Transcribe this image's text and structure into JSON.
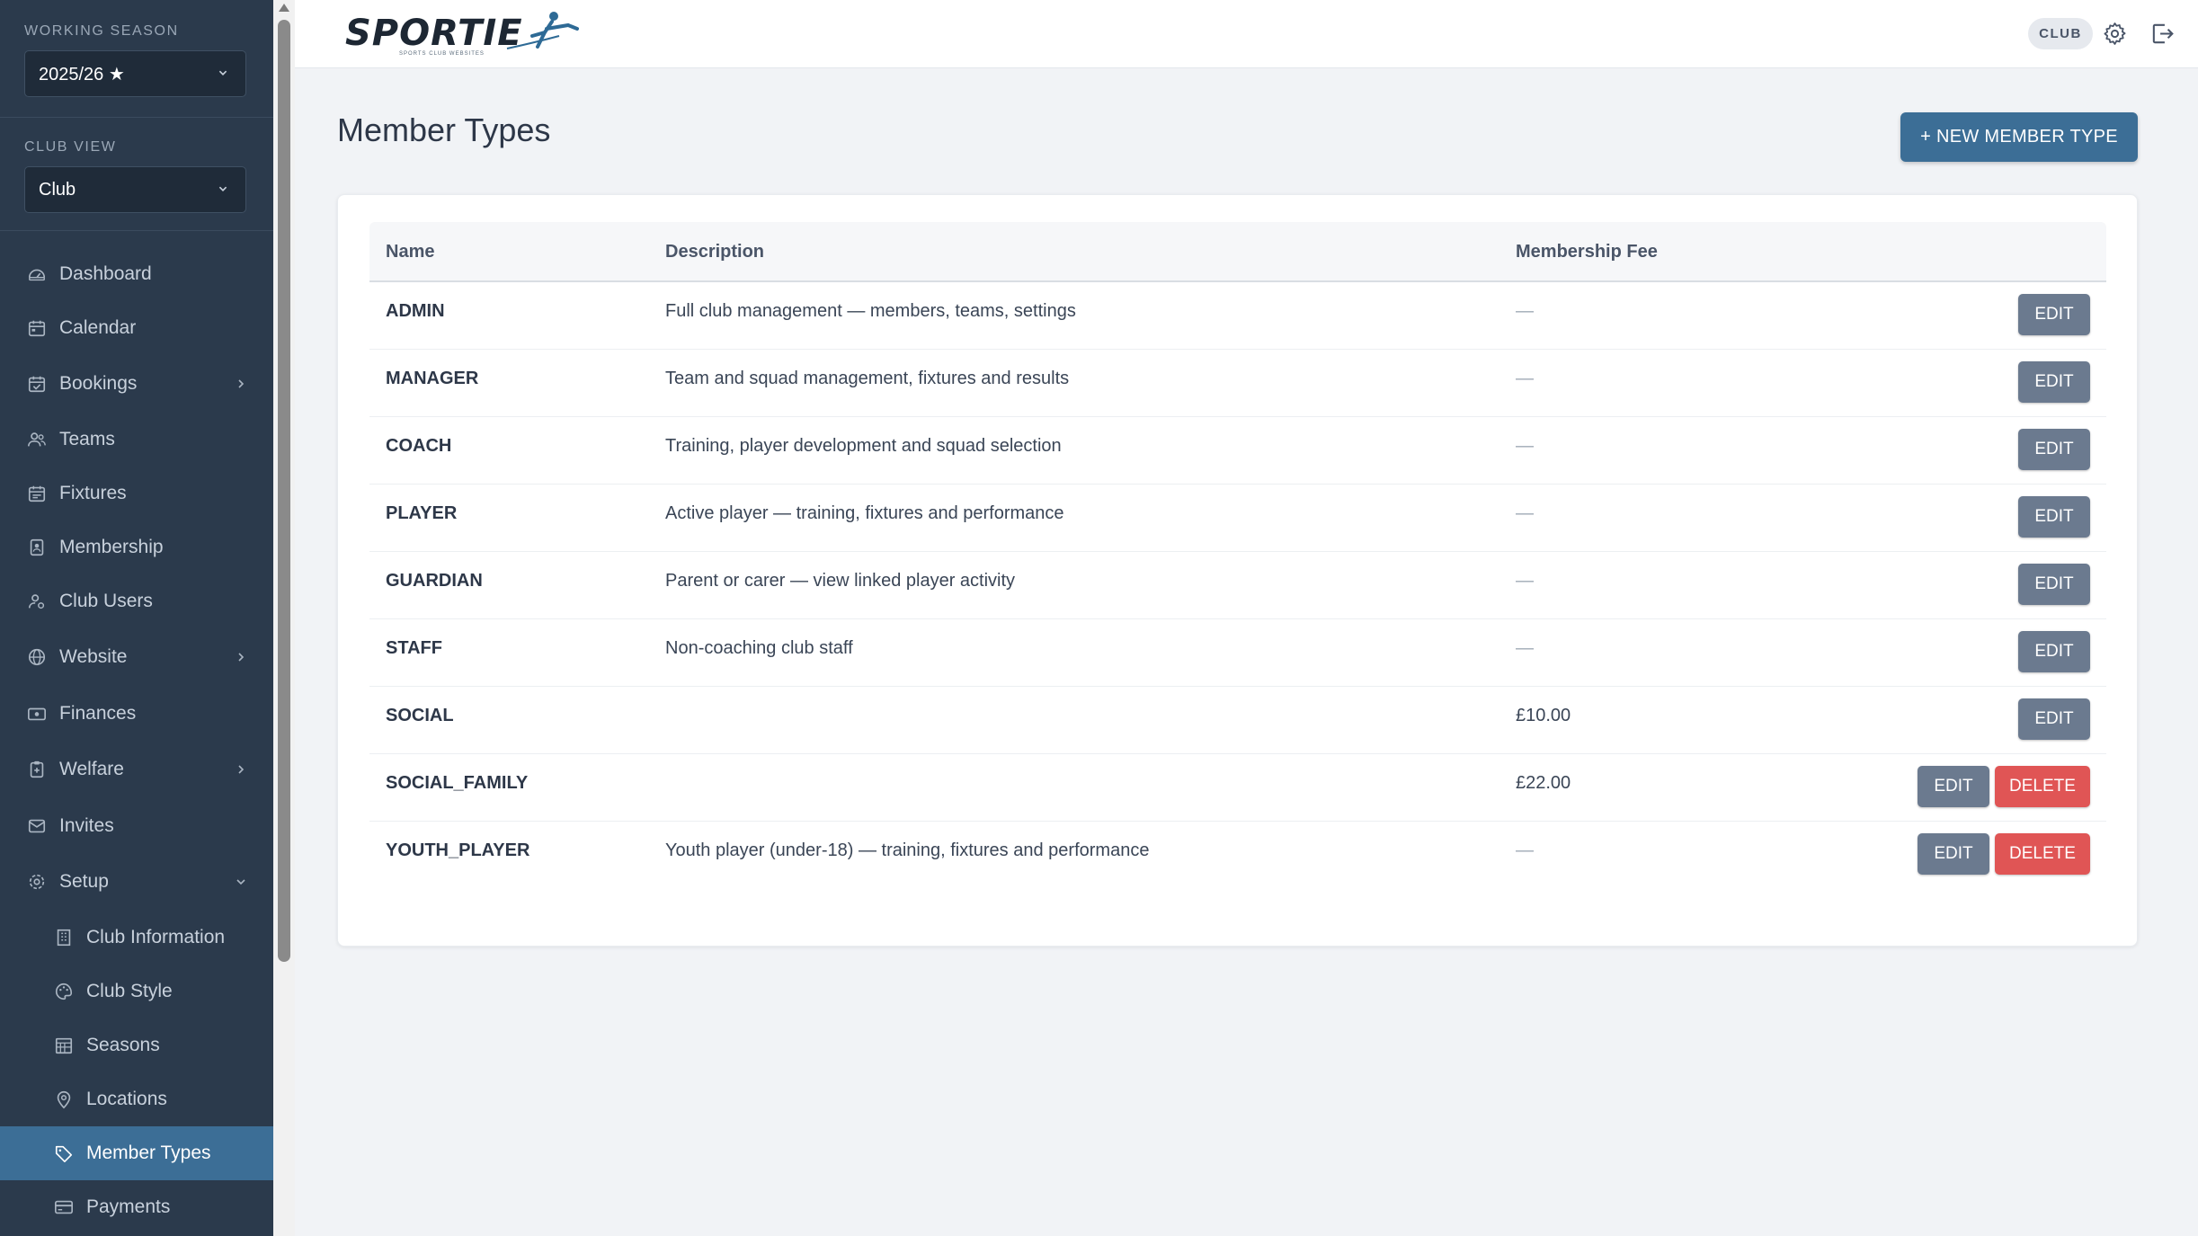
{
  "sidebar": {
    "working_season_label": "WORKING SEASON",
    "working_season_value": "2025/26 ★",
    "club_view_label": "CLUB VIEW",
    "club_view_value": "Club",
    "items": [
      {
        "label": "Dashboard",
        "icon": "gauge-icon"
      },
      {
        "label": "Calendar",
        "icon": "calendar-icon"
      },
      {
        "label": "Bookings",
        "icon": "calendar-check-icon"
      },
      {
        "label": "Teams",
        "icon": "users-icon"
      },
      {
        "label": "Fixtures",
        "icon": "calendar-week-icon"
      },
      {
        "label": "Membership",
        "icon": "id-badge-icon"
      },
      {
        "label": "Club Users",
        "icon": "user-gear-icon"
      },
      {
        "label": "Website",
        "icon": "globe-icon"
      },
      {
        "label": "Finances",
        "icon": "money-icon"
      },
      {
        "label": "Welfare",
        "icon": "clipboard-icon"
      },
      {
        "label": "Invites",
        "icon": "envelope-icon"
      },
      {
        "label": "Setup",
        "icon": "gear-icon"
      }
    ],
    "setup_items": [
      {
        "label": "Club Information",
        "icon": "building-icon"
      },
      {
        "label": "Club Style",
        "icon": "palette-icon"
      },
      {
        "label": "Seasons",
        "icon": "calendar-grid-icon"
      },
      {
        "label": "Locations",
        "icon": "map-pin-icon"
      },
      {
        "label": "Member Types",
        "icon": "tag-icon"
      },
      {
        "label": "Payments",
        "icon": "credit-card-icon"
      }
    ]
  },
  "header": {
    "brand": "SPORTIE",
    "brand_tagline": "SPORTS CLUB WEBSITES",
    "role_badge": "CLUB"
  },
  "main": {
    "title": "Member Types",
    "new_button": "+ NEW MEMBER TYPE",
    "columns": [
      "Name",
      "Description",
      "Membership Fee"
    ],
    "rows": [
      {
        "name": "ADMIN",
        "description": "Full club management — members, teams, settings",
        "fee": "—",
        "edit": "EDIT"
      },
      {
        "name": "MANAGER",
        "description": "Team and squad management, fixtures and results",
        "fee": "—",
        "edit": "EDIT"
      },
      {
        "name": "COACH",
        "description": "Training, player development and squad selection",
        "fee": "—",
        "edit": "EDIT"
      },
      {
        "name": "PLAYER",
        "description": "Active player — training, fixtures and performance",
        "fee": "—",
        "edit": "EDIT"
      },
      {
        "name": "GUARDIAN",
        "description": "Parent or carer — view linked player activity",
        "fee": "—",
        "edit": "EDIT"
      },
      {
        "name": "STAFF",
        "description": "Non-coaching club staff",
        "fee": "—",
        "edit": "EDIT"
      },
      {
        "name": "SOCIAL",
        "description": "",
        "fee": "£10.00",
        "edit": "EDIT"
      },
      {
        "name": "SOCIAL_FAMILY",
        "description": "",
        "fee": "£22.00",
        "edit": "EDIT",
        "delete": "DELETE"
      },
      {
        "name": "YOUTH_PLAYER",
        "description": "Youth player (under-18) — training, fixtures and performance",
        "fee": "—",
        "edit": "EDIT",
        "delete": "DELETE"
      }
    ]
  },
  "colors": {
    "sidebar_bg": "#2b3a4c",
    "accent": "#3c6e96",
    "edit_button": "#6b7a8f",
    "delete_button": "#e05555"
  }
}
